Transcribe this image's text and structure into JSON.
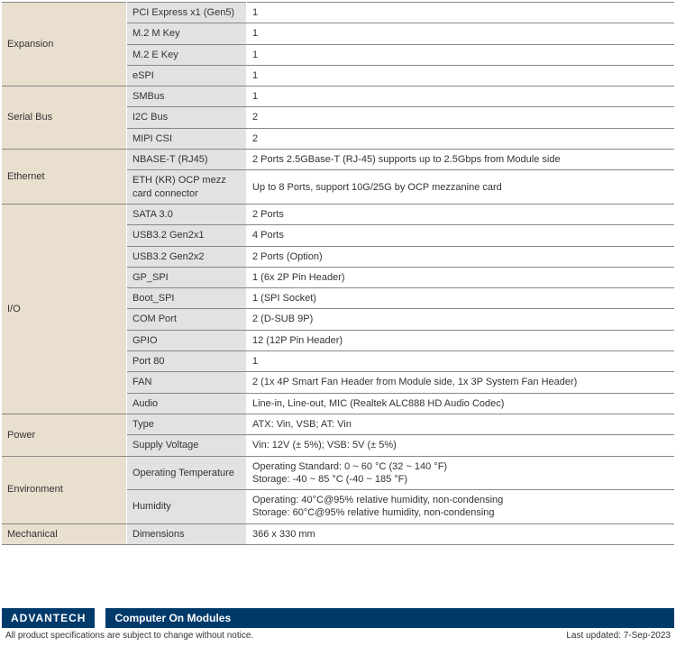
{
  "groups": [
    {
      "name": "Expansion",
      "rows": [
        {
          "sub": "PCI Express x1 (Gen5)",
          "val": "1"
        },
        {
          "sub": "M.2 M Key",
          "val": "1"
        },
        {
          "sub": "M.2 E Key",
          "val": "1"
        },
        {
          "sub": "eSPI",
          "val": "1"
        }
      ]
    },
    {
      "name": "Serial Bus",
      "rows": [
        {
          "sub": "SMBus",
          "val": "1"
        },
        {
          "sub": "I2C Bus",
          "val": "2"
        },
        {
          "sub": "MIPI CSI",
          "val": "2"
        }
      ]
    },
    {
      "name": "Ethernet",
      "rows": [
        {
          "sub": "NBASE-T (RJ45)",
          "val": "2 Ports 2.5GBase-T (RJ-45) supports up to 2.5Gbps from Module side"
        },
        {
          "sub": "ETH (KR) OCP mezz card connector",
          "val": "Up to 8 Ports, support 10G/25G by OCP mezzanine card"
        }
      ]
    },
    {
      "name": "I/O",
      "rows": [
        {
          "sub": "SATA 3.0",
          "val": "2 Ports"
        },
        {
          "sub": "USB3.2 Gen2x1",
          "val": "4 Ports"
        },
        {
          "sub": "USB3.2 Gen2x2",
          "val": "2 Ports (Option)"
        },
        {
          "sub": "GP_SPI",
          "val": "1 (6x 2P Pin Header)"
        },
        {
          "sub": "Boot_SPI",
          "val": "1 (SPI Socket)"
        },
        {
          "sub": "COM Port",
          "val": "2 (D-SUB 9P)"
        },
        {
          "sub": "GPIO",
          "val": "12 (12P Pin Header)"
        },
        {
          "sub": "Port 80",
          "val": "1"
        },
        {
          "sub": "FAN",
          "val": "2 (1x 4P Smart Fan Header from Module side, 1x 3P System Fan Header)"
        },
        {
          "sub": "Audio",
          "val": "Line-in, Line-out, MIC (Realtek ALC888 HD Audio Codec)"
        }
      ]
    },
    {
      "name": "Power",
      "rows": [
        {
          "sub": "Type",
          "val": "ATX: Vin, VSB; AT: Vin"
        },
        {
          "sub": "Supply Voltage",
          "val": "Vin: 12V (± 5%); VSB: 5V (± 5%)"
        }
      ]
    },
    {
      "name": "Environment",
      "rows": [
        {
          "sub": "Operating Temperature",
          "val": "Operating Standard: 0 ~ 60 °C (32 ~ 140 °F)\nStorage: -40 ~ 85 °C (-40 ~ 185 °F)"
        },
        {
          "sub": "Humidity",
          "val": "Operating: 40°C@95% relative humidity, non-condensing\nStorage: 60°C@95% relative humidity, non-condensing"
        }
      ]
    },
    {
      "name": "Mechanical",
      "rows": [
        {
          "sub": "Dimensions",
          "val": "366 x 330 mm"
        }
      ]
    }
  ],
  "footer": {
    "brand": "ADVANTECH",
    "tagline": "Computer On Modules",
    "disclaimer": "All product specifications are subject to change without notice.",
    "updated": "Last updated: 7-Sep-2023"
  }
}
